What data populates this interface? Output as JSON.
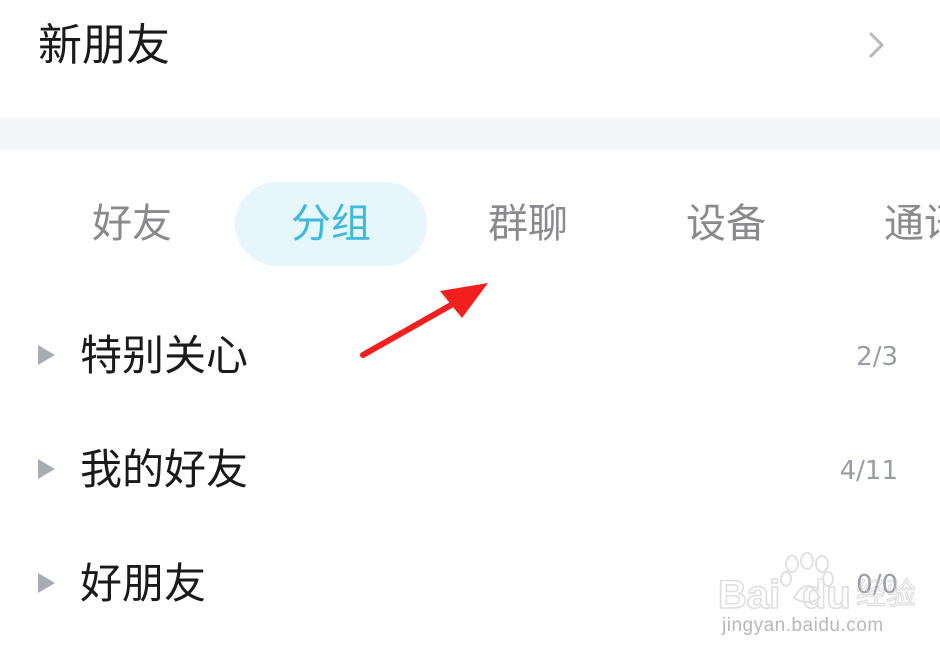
{
  "header": {
    "new_friends_label": "新朋友"
  },
  "tabs": [
    {
      "label": "好友",
      "selected": false
    },
    {
      "label": "分组",
      "selected": true
    },
    {
      "label": "群聊",
      "selected": false
    },
    {
      "label": "设备",
      "selected": false
    },
    {
      "label": "通讯录",
      "selected": false
    }
  ],
  "groups": [
    {
      "name": "特别关心",
      "count": "2/3"
    },
    {
      "name": "我的好友",
      "count": "4/11"
    },
    {
      "name": "好朋友",
      "count": "0/0"
    }
  ],
  "colors": {
    "accent": "#3cb9dd",
    "accent_bg": "#e7f6fb",
    "annotation_arrow": "#f21f1f"
  },
  "watermark": {
    "brand": "Baidu经验",
    "url": "jingyan.baidu.com"
  }
}
